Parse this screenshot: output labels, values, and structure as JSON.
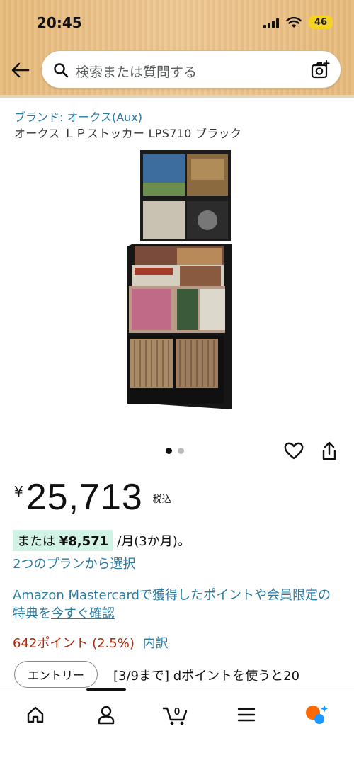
{
  "status_bar": {
    "time": "20:45",
    "battery": "46"
  },
  "search": {
    "placeholder": "検索または質問する"
  },
  "product": {
    "brand": "ブランド: オークス(Aux)",
    "title": "オークス ＬＰストッカー LPS710 ブラック",
    "image_dots": {
      "count": 2,
      "active": 0
    },
    "price_symbol": "¥",
    "price": "25,713",
    "tax_label": "税込",
    "installment_prefix": "または",
    "installment_amount": "¥8,571",
    "installment_suffix": "/月(3か月)。",
    "plans_link": "2つのプランから選択",
    "mastercard_text": "Amazon Mastercardで獲得したポイントや会員限定の特典を",
    "mastercard_link": "今すぐ確認",
    "points": "642ポイント (2.5%)",
    "points_link": "内訳",
    "entry_button": "エントリー",
    "dpoint_text": "[3/9まで] dポイントを使うと20"
  },
  "bottom_nav": {
    "items": [
      {
        "icon": "home-icon"
      },
      {
        "icon": "account-icon"
      },
      {
        "icon": "cart-icon",
        "badge": "0"
      },
      {
        "icon": "menu-icon"
      },
      {
        "icon": "rufus-ai-icon"
      }
    ],
    "active_index": 1
  },
  "colors": {
    "header_bg": "#ebc187",
    "link": "#2a7aa0",
    "price_red": "#b12704",
    "installment_highlight": "#d3f2e6",
    "battery": "#f5d224",
    "ai_orange": "#ff6a00",
    "ai_blue": "#1a98ff"
  }
}
